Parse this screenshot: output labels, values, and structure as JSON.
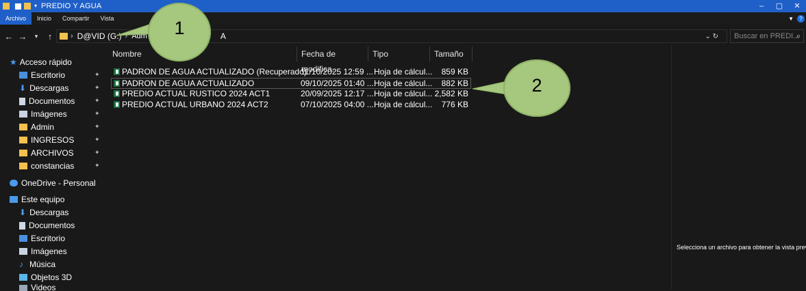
{
  "window": {
    "title": "PREDIO Y AGUA"
  },
  "ribbon": {
    "tabs": [
      "Archivo",
      "Inicio",
      "Compartir",
      "Vista"
    ]
  },
  "address": {
    "drive": "D@VID (G:)",
    "hidden_segment": "Adm",
    "tail_char": "A"
  },
  "search": {
    "placeholder": "Buscar en PREDI..."
  },
  "sidebar": {
    "quick_access": "Acceso rápido",
    "pinned": [
      "Escritorio",
      "Descargas",
      "Documentos",
      "Imágenes",
      "Admin",
      "INGRESOS",
      "ARCHIVOS",
      "constancias"
    ],
    "onedrive": "OneDrive - Personal",
    "this_pc": "Este equipo",
    "pc_items": [
      "Descargas",
      "Documentos",
      "Escritorio",
      "Imágenes",
      "Música",
      "Objetos 3D",
      "Videos"
    ]
  },
  "columns": {
    "name": "Nombre",
    "date": "Fecha de modifica...",
    "type": "Tipo",
    "size": "Tamaño"
  },
  "files": [
    {
      "name": "PADRON DE AGUA ACTUALIZADO (Recuperado)",
      "date": "11/10/2025 12:59 ...",
      "type": "Hoja de cálcul...",
      "size": "859 KB"
    },
    {
      "name": "PADRON DE AGUA ACTUALIZADO",
      "date": "09/10/2025 01:40 ...",
      "type": "Hoja de cálcul...",
      "size": "882 KB"
    },
    {
      "name": "PREDIO ACTUAL RUSTICO 2024 ACT1",
      "date": "20/09/2025 12:17 ...",
      "type": "Hoja de cálcul...",
      "size": "2,582 KB"
    },
    {
      "name": "PREDIO ACTUAL URBANO 2024 ACT2",
      "date": "07/10/2025 04:00 ...",
      "type": "Hoja de cálcul...",
      "size": "776 KB"
    }
  ],
  "preview": {
    "message": "Selecciona un archivo para obtener la vista previa."
  },
  "callouts": {
    "one": "1",
    "two": "2"
  },
  "colors": {
    "accent": "#1f5fc8",
    "callout": "#a6c77e",
    "excel": "#1d6f42",
    "folder": "#f2c14e"
  }
}
